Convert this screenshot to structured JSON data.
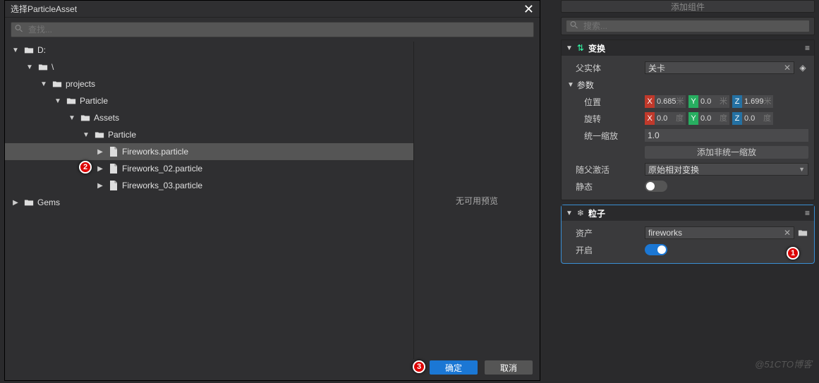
{
  "dialog": {
    "title": "选择ParticleAsset",
    "search_placeholder": "查找...",
    "preview_text": "无可用预览",
    "ok_label": "确定",
    "cancel_label": "取消",
    "tree": [
      {
        "label": "D:",
        "indent": 0,
        "expanded": true,
        "type": "folder"
      },
      {
        "label": "\\",
        "indent": 1,
        "expanded": true,
        "type": "folder"
      },
      {
        "label": "projects",
        "indent": 2,
        "expanded": true,
        "type": "folder"
      },
      {
        "label": "Particle",
        "indent": 3,
        "expanded": true,
        "type": "folder"
      },
      {
        "label": "Assets",
        "indent": 4,
        "expanded": true,
        "type": "folder"
      },
      {
        "label": "Particle",
        "indent": 5,
        "expanded": true,
        "type": "folder"
      },
      {
        "label": "Fireworks.particle",
        "indent": 6,
        "expanded": false,
        "type": "file",
        "selected": true,
        "has_children": true
      },
      {
        "label": "Fireworks_02.particle",
        "indent": 6,
        "expanded": false,
        "type": "file",
        "has_children": true
      },
      {
        "label": "Fireworks_03.particle",
        "indent": 6,
        "expanded": false,
        "type": "file",
        "has_children": true
      },
      {
        "label": "Gems",
        "indent": 0,
        "expanded": false,
        "type": "folder",
        "has_children": true
      }
    ]
  },
  "right_panel": {
    "add_component_label": "添加组件",
    "search_placeholder": "搜索...",
    "transform": {
      "title": "变换",
      "parent_label": "父实体",
      "parent_value": "关卡",
      "params_label": "参数",
      "position_label": "位置",
      "rotation_label": "旋转",
      "scale_label": "统一缩放",
      "scale_value": "1.0",
      "add_non_uniform_label": "添加非统一缩放",
      "follow_parent_label": "随父激活",
      "follow_parent_value": "原始相对变换",
      "static_label": "静态",
      "position": {
        "x": "0.685",
        "xu": "米",
        "y": "0.0",
        "yu": "米",
        "z": "1.699",
        "zu": "米"
      },
      "rotation": {
        "x": "0.0",
        "xu": "度",
        "y": "0.0",
        "yu": "度",
        "z": "0.0",
        "zu": "度"
      }
    },
    "particle": {
      "title": "粒子",
      "asset_label": "资产",
      "asset_value": "fireworks",
      "enable_label": "开启"
    }
  },
  "watermark": "@51CTO博客"
}
